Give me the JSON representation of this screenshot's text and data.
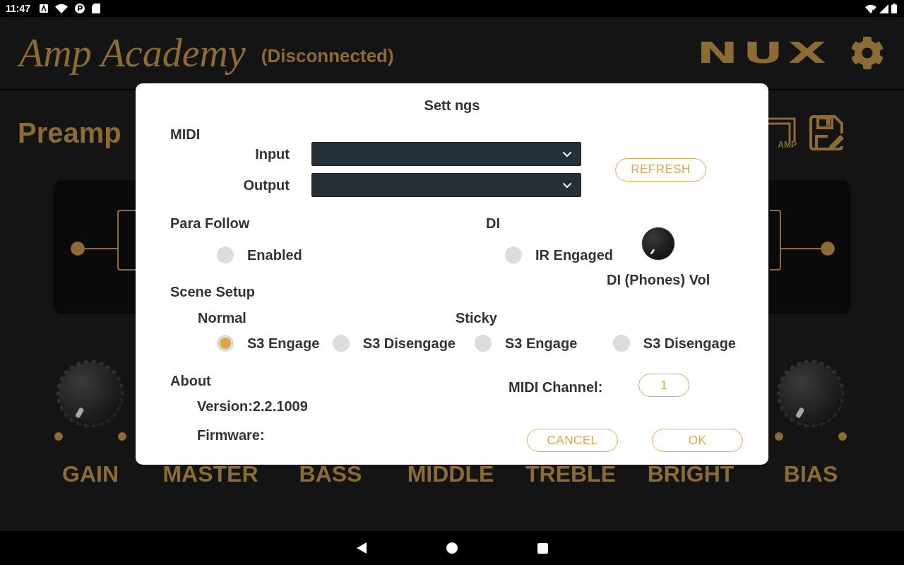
{
  "status_bar": {
    "time": "11:47"
  },
  "header": {
    "logo": "Amp Academy",
    "connection_status": "(Disconnected)",
    "brand": "NUX"
  },
  "preamp": {
    "title": "Preamp",
    "amp_icon_label": "AMP",
    "knobs": [
      {
        "kind": "knob",
        "label": "GAIN"
      },
      {
        "kind": "label",
        "label": "MASTER"
      },
      {
        "kind": "label",
        "label": "BASS"
      },
      {
        "kind": "label",
        "label": "MIDDLE"
      },
      {
        "kind": "label",
        "label": "TREBLE"
      },
      {
        "kind": "label",
        "label": "BRIGHT"
      },
      {
        "kind": "knob",
        "label": "BIAS"
      }
    ]
  },
  "settings_dialog": {
    "title": "Sett ngs",
    "midi": {
      "heading": "MIDI",
      "ports": [
        {
          "label": "Input"
        },
        {
          "label": "Output"
        }
      ],
      "refresh_button": "REFRESH"
    },
    "para_follow": {
      "heading": "Para Follow",
      "option": {
        "label": "Enabled",
        "checked": false
      }
    },
    "di": {
      "heading": "DI",
      "option": {
        "label": "IR Engaged",
        "checked": false
      },
      "volume_knob": {
        "label": "DI (Phones) Vol"
      }
    },
    "scene_setup": {
      "heading": "Scene Setup",
      "groups": [
        {
          "heading": "Normal",
          "options": [
            {
              "label": "S3 Engage",
              "selected": true
            },
            {
              "label": "S3 Disengage",
              "selected": false
            }
          ]
        },
        {
          "heading": "Sticky",
          "options": [
            {
              "label": "S3 Engage",
              "selected": false
            },
            {
              "label": "S3 Disengage",
              "selected": false
            }
          ]
        }
      ]
    },
    "about": {
      "heading": "About",
      "version": "Version:2.2.1009",
      "firmware": "Firmware:"
    },
    "midi_channel": {
      "label": "MIDI Channel:",
      "value": "1"
    },
    "buttons": [
      "CANCEL",
      "OK"
    ]
  }
}
